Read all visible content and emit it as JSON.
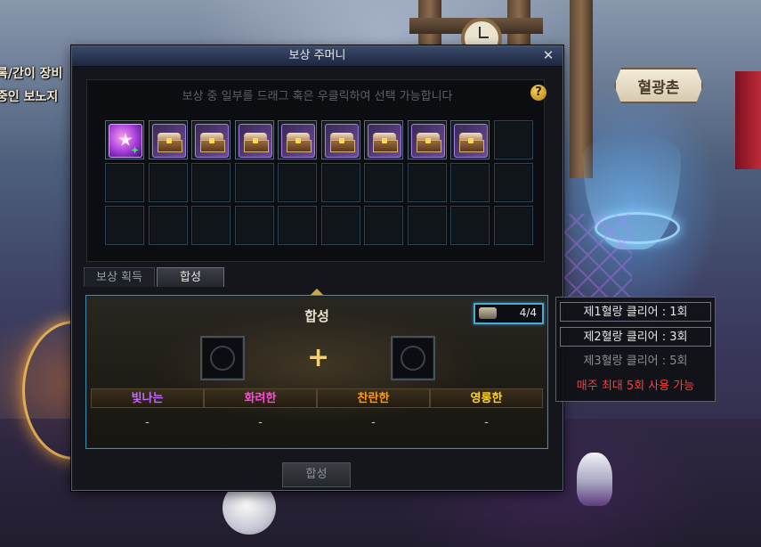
{
  "background": {
    "left_text_lines": [
      "록/간이 장비",
      "중인 보노지"
    ],
    "town_sign": "혈광촌"
  },
  "window": {
    "title": "보상 주머니",
    "close_symbol": "✕",
    "hint": "보상 중 일부를 드래그 혹은 우클릭하여 선택 가능합니다",
    "help_symbol": "?",
    "inventory": {
      "rows": 3,
      "cols": 10,
      "filled": [
        "special-item",
        "reward-box",
        "reward-box",
        "reward-box",
        "reward-box",
        "reward-box",
        "reward-box",
        "reward-box",
        "reward-box"
      ]
    },
    "tabs": [
      {
        "label": "보상 획득",
        "active": false
      },
      {
        "label": "합성",
        "active": true
      }
    ],
    "synthesis": {
      "title": "합성",
      "counter": "4/4",
      "plus": "+",
      "ranks": [
        {
          "label": "빛나는",
          "value": "-",
          "color": "#c068ff"
        },
        {
          "label": "화려한",
          "value": "-",
          "color": "#ff4bd8"
        },
        {
          "label": "찬란한",
          "value": "-",
          "color": "#ff9a1a"
        },
        {
          "label": "영롱한",
          "value": "-",
          "color": "#ffd21f"
        }
      ]
    },
    "bottom_button": "합성"
  },
  "tooltip": {
    "rows": [
      {
        "text": "제1혈랑 클리어 : 1회",
        "color": "#e6e6e6"
      },
      {
        "text": "제2혈랑 클리어 : 3회",
        "color": "#e6e6e6"
      },
      {
        "text": "제3혈랑 클리어 : 5회",
        "color": "#8c8c8c"
      },
      {
        "text": "매주 최대 5회 사용 가능",
        "color": "#ff3b3b"
      }
    ]
  }
}
